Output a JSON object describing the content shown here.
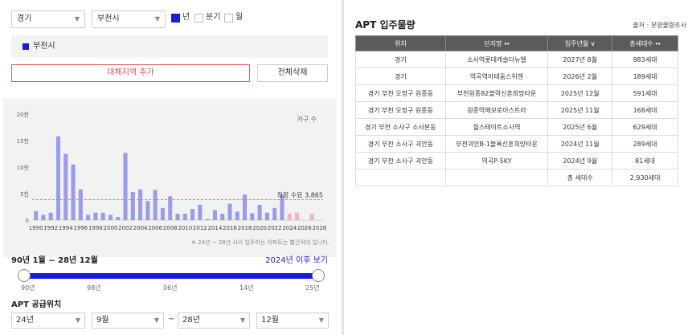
{
  "filters": {
    "province": "경기",
    "city": "부천시",
    "period_options": [
      {
        "label": "년",
        "checked": true
      },
      {
        "label": "분기",
        "checked": false
      },
      {
        "label": "월",
        "checked": false
      }
    ]
  },
  "selected_region": "부천시",
  "buttons": {
    "add_region": "대체지역 추가",
    "delete_all": "전체삭제"
  },
  "chart_data": {
    "type": "bar",
    "ylabel": "가구 수",
    "ylim": [
      0,
      20000
    ],
    "y_ticks": [
      "0",
      "5천",
      "10천",
      "15천",
      "20천"
    ],
    "x_tick_labels": [
      "1990",
      "1992",
      "1994",
      "1996",
      "1998",
      "2000",
      "2002",
      "2004",
      "2006",
      "2008",
      "2010",
      "2012",
      "2014",
      "2016",
      "2018",
      "2020",
      "2022",
      "2024",
      "2026",
      "2028"
    ],
    "years": [
      1990,
      1991,
      1992,
      1993,
      1994,
      1995,
      1996,
      1997,
      1998,
      1999,
      2000,
      2001,
      2002,
      2003,
      2004,
      2005,
      2006,
      2007,
      2008,
      2009,
      2010,
      2011,
      2012,
      2013,
      2014,
      2015,
      2016,
      2017,
      2018,
      2019,
      2020,
      2021,
      2022,
      2023,
      2024,
      2025,
      2026,
      2027,
      2028
    ],
    "values": [
      1700,
      1000,
      1400,
      15800,
      12500,
      10500,
      5800,
      1000,
      1400,
      1400,
      1000,
      600,
      12700,
      5300,
      5800,
      3600,
      5700,
      2300,
      4500,
      1200,
      1200,
      2100,
      2900,
      200,
      1900,
      1200,
      3100,
      1600,
      4800,
      1300,
      2900,
      1400,
      2300,
      4800,
      1200,
      1400,
      0,
      1200,
      0
    ],
    "forecast_from_year": 2024,
    "colors": {
      "actual": "#9b9bec",
      "forecast": "#f4b3bf",
      "reference": "#e98080"
    },
    "reference_line": {
      "value": 3865,
      "label": "적정 수요 3,865"
    },
    "note": "※ 24년 ~ 28년 사이 입주하는 아파트는 빨간막대 입니다."
  },
  "range": {
    "title": "90년 1월 ~ 28년 12월",
    "link": "2024년 이후 보기",
    "labels": [
      "90년",
      "98년",
      "06년",
      "14년",
      "25년"
    ]
  },
  "supply": {
    "title": "APT 공급위치",
    "from_year": "24년",
    "from_month": "9월",
    "tilde": "~",
    "to_year": "28년",
    "to_month": "12월"
  },
  "apt_table": {
    "title": "APT 입주물량",
    "source": "출처 : 분양물량조사",
    "columns": [
      "위치",
      "단지명 ↔",
      "입주년월 ∨",
      "총세대수 ↔"
    ],
    "rows": [
      [
        "경기",
        "소사역롯데캐슬더뉴엘",
        "2027년 8월",
        "983세대"
      ],
      [
        "경기",
        "역곡역아테움스위첸",
        "2026년 2월",
        "189세대"
      ],
      [
        "경기 부천 오정구 원종동",
        "부천원종82블럭신혼희망타운",
        "2025년 12월",
        "591세대"
      ],
      [
        "경기 부천 오정구 원종동",
        "원종역해모로아스트라",
        "2025년 11월",
        "168세대"
      ],
      [
        "경기 부천 소사구 소사본동",
        "힐스테이트소사역",
        "2025년 6월",
        "629세대"
      ],
      [
        "경기 부천 소사구 괴안동",
        "부천괴안B-1블록신혼희망타운",
        "2024년 11월",
        "289세대"
      ],
      [
        "경기 부천 소사구 괴안동",
        "역곡P-SKY",
        "2024년 9월",
        "81세대"
      ]
    ],
    "total_label": "총 세대수",
    "total_value": "2,930세대"
  }
}
